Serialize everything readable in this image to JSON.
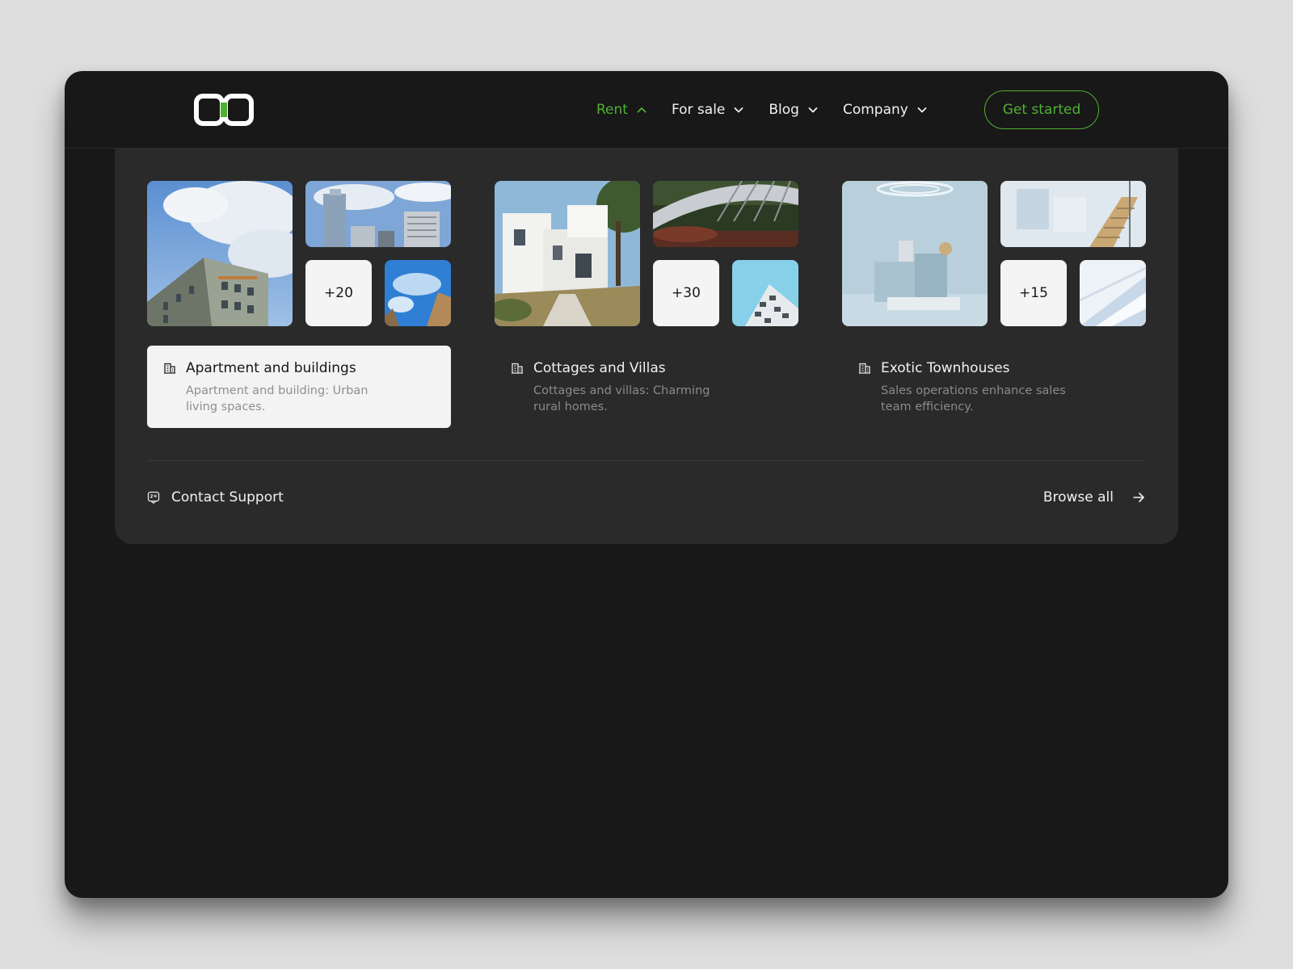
{
  "nav": {
    "items": [
      {
        "label": "Rent",
        "active": true
      },
      {
        "label": "For sale",
        "active": false
      },
      {
        "label": "Blog",
        "active": false
      },
      {
        "label": "Company",
        "active": false
      }
    ],
    "cta_label": "Get started"
  },
  "colors": {
    "accent": "#4fb033",
    "window_bg": "#181818",
    "panel_bg": "#2a2a2a",
    "page_bg": "#dedede"
  },
  "categories": [
    {
      "title": "Apartment and buildings",
      "description": "Apartment and building: Urban living spaces.",
      "count": "+20",
      "selected": true,
      "icon": "building-icon"
    },
    {
      "title": "Cottages and Villas",
      "description": "Cottages and villas: Charming rural homes.",
      "count": "+30",
      "selected": false,
      "icon": "building-icon"
    },
    {
      "title": "Exotic Townhouses",
      "description": "Sales operations enhance sales team efficiency.",
      "count": "+15",
      "selected": false,
      "icon": "building-icon"
    }
  ],
  "footer": {
    "support_label": "Contact Support",
    "support_icon": "support-chat-icon",
    "browse_label": "Browse all",
    "browse_icon": "arrow-right-icon"
  }
}
